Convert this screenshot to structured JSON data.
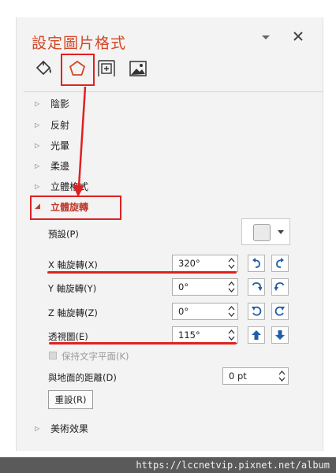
{
  "pane": {
    "title": "設定圖片格式",
    "tabs": [
      {
        "name": "fill-line",
        "icon": "paint-bucket-icon"
      },
      {
        "name": "effects",
        "icon": "pentagon-icon",
        "selected": true
      },
      {
        "name": "size-properties",
        "icon": "size-properties-icon"
      },
      {
        "name": "picture",
        "icon": "picture-icon"
      }
    ]
  },
  "sections": {
    "shadow": "陰影",
    "reflection": "反射",
    "glow": "光暈",
    "soft_edges": "柔邊",
    "bevel_3d": "立體格式",
    "rotation_3d": "立體旋轉",
    "artistic": "美術效果"
  },
  "rotation": {
    "preset_label": "預設(P)",
    "x_label": "X 軸旋轉(X)",
    "x_value": "320°",
    "y_label": "Y 軸旋轉(Y)",
    "y_value": "0°",
    "z_label": "Z 軸旋轉(Z)",
    "z_value": "0°",
    "perspective_label": "透視圖(E)",
    "perspective_value": "115°",
    "keep_text_flat_label": "保持文字平面(K)",
    "distance_label": "與地面的距離(D)",
    "distance_value": "0 pt",
    "reset_label": "重設(R)"
  },
  "watermark": "https://lccnetvip.pixnet.net/album",
  "colors": {
    "accent": "#d24726",
    "annotation": "#e02020",
    "icon_blue": "#1f5fa8"
  }
}
